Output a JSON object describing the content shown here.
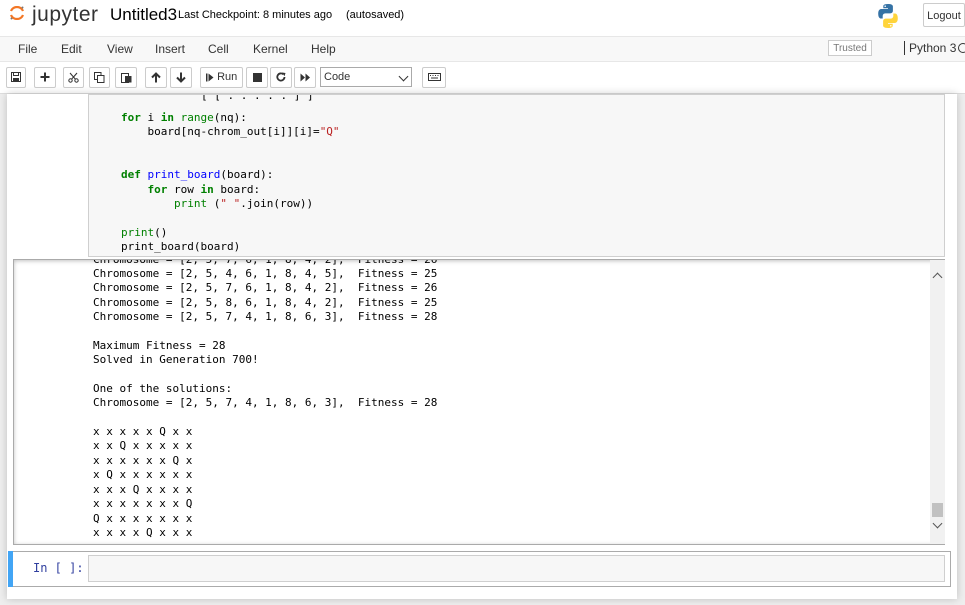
{
  "header": {
    "logo_text": "jupyter",
    "notebook_name": "Untitled3",
    "checkpoint": "Last Checkpoint: 8 minutes ago",
    "autosave": "(autosaved)",
    "logout_label": "Logout"
  },
  "menu": {
    "items": [
      "File",
      "Edit",
      "View",
      "Insert",
      "Cell",
      "Kernel",
      "Help"
    ],
    "trusted": "Trusted",
    "kernel": "Python 3"
  },
  "toolbar": {
    "run_label": "Run",
    "cell_type": "Code"
  },
  "code_cell": {
    "lines": [
      "    for i in range(nq):",
      "        board[nq-chrom_out[i]][i]=\"Q\"",
      "    def print_board(board):",
      "        for row in board:",
      "            print (\" \".join(row))",
      "    print()",
      "    print_board(board)"
    ]
  },
  "output": {
    "lines": [
      "Chromosome = [2, 5, 4, 6, 1, 8, 4, 5],  Fitness = 25",
      "Chromosome = [2, 5, 7, 6, 1, 8, 4, 2],  Fitness = 26",
      "Chromosome = [2, 5, 8, 6, 1, 8, 4, 2],  Fitness = 25",
      "Chromosome = [2, 5, 7, 4, 1, 8, 6, 3],  Fitness = 28",
      "Maximum Fitness = 28",
      "Solved in Generation 700!",
      "One of the solutions:",
      "Chromosome = [2, 5, 7, 4, 1, 8, 6, 3],  Fitness = 28",
      "x x x x x Q x x",
      "x x Q x x x x x",
      "x x x x x x Q x",
      "x Q x x x x x x",
      "x x x Q x x x x",
      "x x x x x x x Q",
      "Q x x x x x x x",
      "x x x x Q x x x"
    ]
  },
  "input_cell": {
    "prompt": "In [ ]:"
  }
}
